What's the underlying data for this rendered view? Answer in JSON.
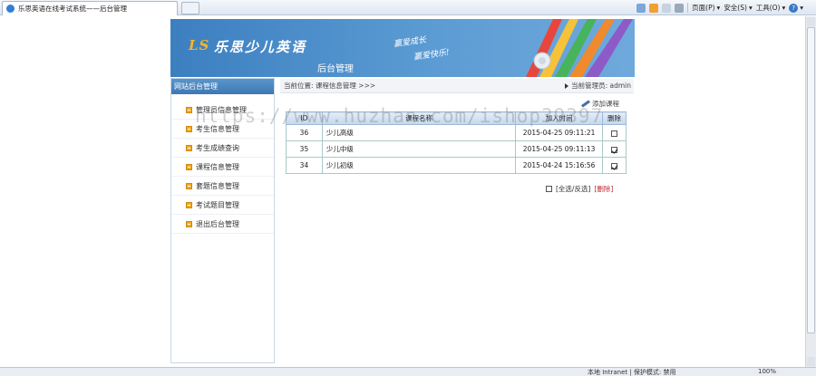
{
  "browser": {
    "tab_title": "乐思英语在线考试系统——后台管理",
    "toolbar": {
      "page_label": "页面(P)",
      "safety_label": "安全(S)",
      "tools_label": "工具(O)",
      "help_label": "?"
    },
    "status": {
      "zone": "本地 Intranet | 保护模式: 禁用",
      "zoom": "100%"
    }
  },
  "banner": {
    "logo": "LS",
    "title": "乐思少儿英语",
    "subtitle": "后台管理",
    "slogan_line1": "赢爱成长",
    "slogan_line2": "赢爱快乐!"
  },
  "sidebar": {
    "heading": "网站后台管理",
    "items": [
      {
        "label": "管理员信息管理"
      },
      {
        "label": "考生信息管理"
      },
      {
        "label": "考生成绩查询"
      },
      {
        "label": "课程信息管理"
      },
      {
        "label": "套题信息管理"
      },
      {
        "label": "考试题目管理"
      },
      {
        "label": "退出后台管理"
      }
    ]
  },
  "breadcrumb": {
    "location": "当前位置: 课程信息管理 >>>",
    "admin": "当前管理员: admin"
  },
  "actions": {
    "add_course": "添加课程"
  },
  "table": {
    "headers": [
      "ID",
      "课程名称",
      "加入时间",
      "删除"
    ],
    "rows": [
      {
        "id": "36",
        "name": "少儿高级",
        "time": "2015-04-25 09:11:21",
        "checked": false
      },
      {
        "id": "35",
        "name": "少儿中级",
        "time": "2015-04-25 09:11:13",
        "checked": true
      },
      {
        "id": "34",
        "name": "少儿初级",
        "time": "2015-04-24 15:16:56",
        "checked": true
      }
    ]
  },
  "bulk": {
    "select_all": "[全选/反选]",
    "delete": "[删除]"
  },
  "watermark": "https://www.huzhan.com/ishop39397",
  "colors": {
    "banner_blue": "#4a8ac8",
    "sidebar_head": "#4a86c0",
    "bullet_orange": "#f2a91f",
    "delete_red": "#c0282a"
  }
}
